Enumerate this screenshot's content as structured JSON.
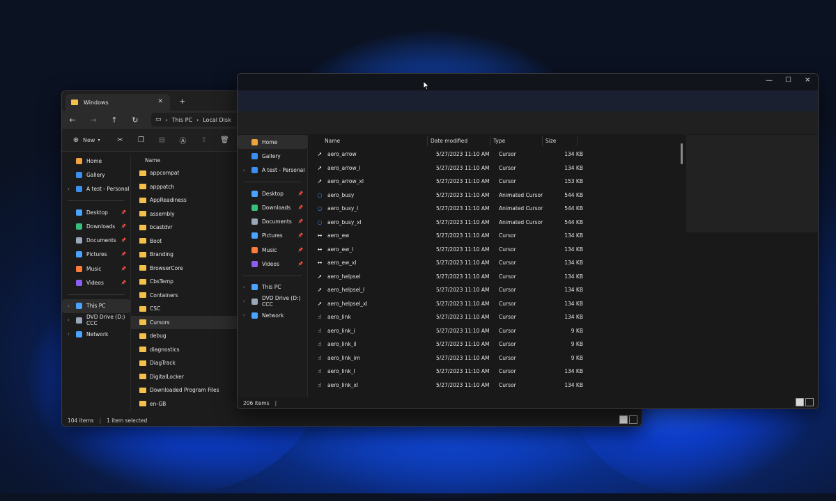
{
  "back_window": {
    "tab_title": "Windows",
    "new_tab_label": "+",
    "address": [
      "This PC",
      "Local Disk"
    ],
    "new_label": "New",
    "sidebar": [
      {
        "label": "Home",
        "icon": "home-icon",
        "color": "#f0a33c"
      },
      {
        "label": "Gallery",
        "icon": "gallery-icon",
        "color": "#3c8ef0"
      },
      {
        "label": "A test - Personal",
        "icon": "onedrive-icon",
        "color": "#3c8ef0",
        "chevron": true
      },
      {
        "sep": true
      },
      {
        "label": "Desktop",
        "icon": "desktop-icon",
        "color": "#4aa3ff",
        "pin": true
      },
      {
        "label": "Downloads",
        "icon": "download-icon",
        "color": "#38c07a",
        "pin": true
      },
      {
        "label": "Documents",
        "icon": "documents-icon",
        "color": "#9aa7b8",
        "pin": true
      },
      {
        "label": "Pictures",
        "icon": "pictures-icon",
        "color": "#4aa3ff",
        "pin": true
      },
      {
        "label": "Music",
        "icon": "music-icon",
        "color": "#ff7b3a",
        "pin": true
      },
      {
        "label": "Videos",
        "icon": "videos-icon",
        "color": "#8d5cf6",
        "pin": true
      },
      {
        "sep": true
      },
      {
        "label": "This PC",
        "icon": "pc-icon",
        "color": "#4aa3ff",
        "chevron": true,
        "selected": true
      },
      {
        "label": "DVD Drive (D:) CCC",
        "icon": "dvd-icon",
        "color": "#9aa7b8",
        "chevron": true
      },
      {
        "label": "Network",
        "icon": "network-icon",
        "color": "#4aa3ff",
        "chevron": true
      }
    ],
    "column_name": "Name",
    "folders": [
      "appcompat",
      "apppatch",
      "AppReadiness",
      "assembly",
      "bcastdvr",
      "Boot",
      "Branding",
      "BrowserCore",
      "CbsTemp",
      "Containers",
      "CSC",
      "Cursors",
      "debug",
      "diagnostics",
      "DiagTrack",
      "DigitalLocker",
      "Downloaded Program Files",
      "en-GB"
    ],
    "selected_folder": "Cursors",
    "status_items": "104 items",
    "status_selected": "1 item selected"
  },
  "front_window": {
    "controls": {
      "minimize": "—",
      "maximize": "☐",
      "close": "✕"
    },
    "sidebar": [
      {
        "label": "Home",
        "icon": "home-icon",
        "color": "#f0a33c",
        "selected": true
      },
      {
        "label": "Gallery",
        "icon": "gallery-icon",
        "color": "#3c8ef0"
      },
      {
        "label": "A test - Personal",
        "icon": "onedrive-icon",
        "color": "#3c8ef0",
        "chevron": true
      },
      {
        "sep": true
      },
      {
        "label": "Desktop",
        "icon": "desktop-icon",
        "color": "#4aa3ff",
        "pin": true
      },
      {
        "label": "Downloads",
        "icon": "download-icon",
        "color": "#38c07a",
        "pin": true
      },
      {
        "label": "Documents",
        "icon": "documents-icon",
        "color": "#9aa7b8",
        "pin": true
      },
      {
        "label": "Pictures",
        "icon": "pictures-icon",
        "color": "#4aa3ff",
        "pin": true
      },
      {
        "label": "Music",
        "icon": "music-icon",
        "color": "#ff7b3a",
        "pin": true
      },
      {
        "label": "Videos",
        "icon": "videos-icon",
        "color": "#8d5cf6",
        "pin": true
      },
      {
        "sep": true
      },
      {
        "label": "This PC",
        "icon": "pc-icon",
        "color": "#4aa3ff",
        "chevron": true
      },
      {
        "label": "DVD Drive (D:) CCC",
        "icon": "dvd-icon",
        "color": "#9aa7b8",
        "chevron": true
      },
      {
        "label": "Network",
        "icon": "network-icon",
        "color": "#4aa3ff",
        "chevron": true
      }
    ],
    "columns": [
      "Name",
      "Date modified",
      "Type",
      "Size"
    ],
    "files": [
      {
        "name": "aero_arrow",
        "date": "5/27/2023 11:10 AM",
        "type": "Cursor",
        "size": "134 KB",
        "icon": "arrow-cursor-icon",
        "glyph": "➚"
      },
      {
        "name": "aero_arrow_l",
        "date": "5/27/2023 11:10 AM",
        "type": "Cursor",
        "size": "134 KB",
        "icon": "arrow-cursor-icon",
        "glyph": "➚"
      },
      {
        "name": "aero_arrow_xl",
        "date": "5/27/2023 11:10 AM",
        "type": "Cursor",
        "size": "153 KB",
        "icon": "arrow-cursor-icon",
        "glyph": "➚"
      },
      {
        "name": "aero_busy",
        "date": "5/27/2023 11:10 AM",
        "type": "Animated Cursor",
        "size": "544 KB",
        "icon": "busy-cursor-icon",
        "glyph": "○"
      },
      {
        "name": "aero_busy_l",
        "date": "5/27/2023 11:10 AM",
        "type": "Animated Cursor",
        "size": "544 KB",
        "icon": "busy-cursor-icon",
        "glyph": "○"
      },
      {
        "name": "aero_busy_xl",
        "date": "5/27/2023 11:10 AM",
        "type": "Animated Cursor",
        "size": "544 KB",
        "icon": "busy-cursor-icon",
        "glyph": "○"
      },
      {
        "name": "aero_ew",
        "date": "5/27/2023 11:10 AM",
        "type": "Cursor",
        "size": "134 KB",
        "icon": "resize-ew-icon",
        "glyph": "↔"
      },
      {
        "name": "aero_ew_l",
        "date": "5/27/2023 11:10 AM",
        "type": "Cursor",
        "size": "134 KB",
        "icon": "resize-ew-icon",
        "glyph": "↔"
      },
      {
        "name": "aero_ew_xl",
        "date": "5/27/2023 11:10 AM",
        "type": "Cursor",
        "size": "134 KB",
        "icon": "resize-ew-icon",
        "glyph": "↔"
      },
      {
        "name": "aero_helpsel",
        "date": "5/27/2023 11:10 AM",
        "type": "Cursor",
        "size": "134 KB",
        "icon": "help-cursor-icon",
        "glyph": "➚"
      },
      {
        "name": "aero_helpsel_l",
        "date": "5/27/2023 11:10 AM",
        "type": "Cursor",
        "size": "134 KB",
        "icon": "help-cursor-icon",
        "glyph": "➚"
      },
      {
        "name": "aero_helpsel_xl",
        "date": "5/27/2023 11:10 AM",
        "type": "Cursor",
        "size": "134 KB",
        "icon": "help-cursor-icon",
        "glyph": "➚"
      },
      {
        "name": "aero_link",
        "date": "5/27/2023 11:10 AM",
        "type": "Cursor",
        "size": "134 KB",
        "icon": "hand-cursor-icon",
        "glyph": "☝"
      },
      {
        "name": "aero_link_i",
        "date": "5/27/2023 11:10 AM",
        "type": "Cursor",
        "size": "9 KB",
        "icon": "hand-cursor-icon",
        "glyph": "☝"
      },
      {
        "name": "aero_link_il",
        "date": "5/27/2023 11:10 AM",
        "type": "Cursor",
        "size": "9 KB",
        "icon": "hand-cursor-icon",
        "glyph": "☝"
      },
      {
        "name": "aero_link_im",
        "date": "5/27/2023 11:10 AM",
        "type": "Cursor",
        "size": "9 KB",
        "icon": "hand-cursor-icon",
        "glyph": "☝"
      },
      {
        "name": "aero_link_l",
        "date": "5/27/2023 11:10 AM",
        "type": "Cursor",
        "size": "134 KB",
        "icon": "hand-cursor-icon",
        "glyph": "☝"
      },
      {
        "name": "aero_link_xl",
        "date": "5/27/2023 11:10 AM",
        "type": "Cursor",
        "size": "134 KB",
        "icon": "hand-cursor-icon",
        "glyph": "☝"
      }
    ],
    "status_items": "206 items"
  }
}
